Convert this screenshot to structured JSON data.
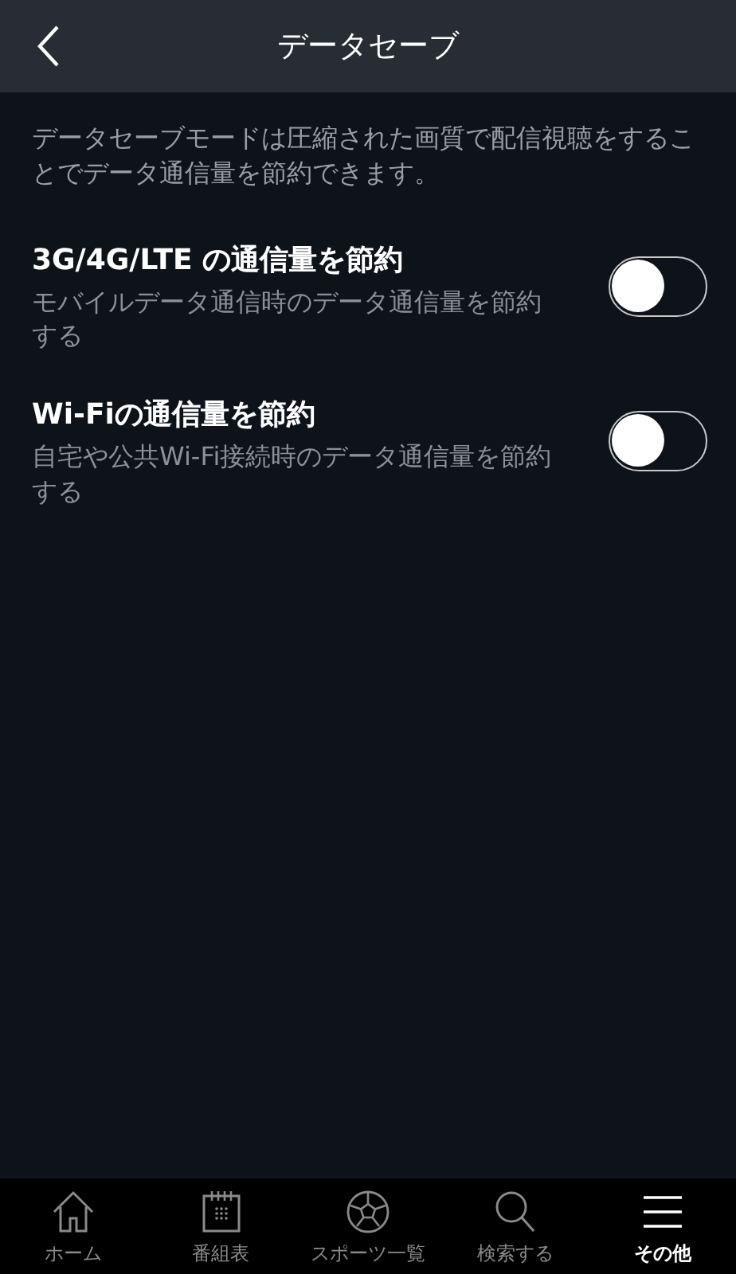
{
  "header": {
    "title": "データセーブ"
  },
  "description": "データセーブモードは圧縮された画質で配信視聴をすることでデータ通信量を節約できます。",
  "settings": [
    {
      "title": "3G/4G/LTE の通信量を節約",
      "subtitle": "モバイルデータ通信時のデータ通信量を節約する",
      "on": false
    },
    {
      "title": "Wi-Fiの通信量を節約",
      "subtitle": "自宅や公共Wi-Fi接続時のデータ通信量を節約する",
      "on": false
    }
  ],
  "nav": [
    {
      "kind": "home",
      "label": "ホーム",
      "selected": false
    },
    {
      "kind": "calendar",
      "label": "番組表",
      "selected": false
    },
    {
      "kind": "ball",
      "label": "スポーツ一覧",
      "selected": false
    },
    {
      "kind": "search",
      "label": "検索する",
      "selected": false
    },
    {
      "kind": "menu",
      "label": "その他",
      "selected": true
    }
  ]
}
